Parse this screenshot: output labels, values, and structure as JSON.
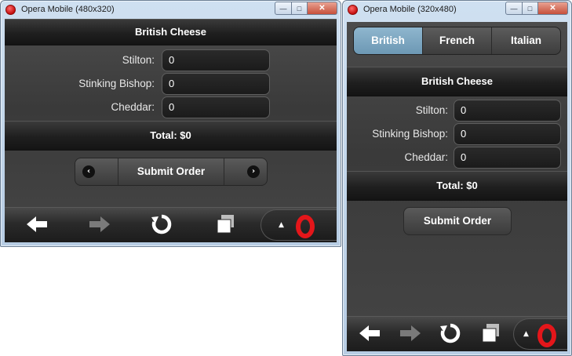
{
  "window_left": {
    "title": "Opera Mobile (480x320)",
    "header": "British Cheese",
    "fields": [
      {
        "label": "Stilton:",
        "value": "0"
      },
      {
        "label": "Stinking Bishop:",
        "value": "0"
      },
      {
        "label": "Cheddar:",
        "value": "0"
      }
    ],
    "total": "Total: $0",
    "submit_label": "Submit Order",
    "prev_icon": "chevron-left-icon",
    "next_icon": "chevron-right-icon"
  },
  "window_right": {
    "title": "Opera Mobile (320x480)",
    "tabs": [
      {
        "label": "British",
        "active": true
      },
      {
        "label": "French",
        "active": false
      },
      {
        "label": "Italian",
        "active": false
      }
    ],
    "header": "British Cheese",
    "fields": [
      {
        "label": "Stilton:",
        "value": "0"
      },
      {
        "label": "Stinking Bishop:",
        "value": "0"
      },
      {
        "label": "Cheddar:",
        "value": "0"
      }
    ],
    "total": "Total: $0",
    "submit_label": "Submit Order"
  },
  "window_controls": {
    "minimize": "—",
    "maximize": "□",
    "close": "✕"
  },
  "browser_bar": {
    "icons": [
      "back-arrow-icon",
      "forward-arrow-icon",
      "reload-icon",
      "tabs-icon",
      "opera-menu-icon"
    ],
    "menu_caret": "▲"
  },
  "colors": {
    "accent_tab": "#7fa9c3",
    "opera_red": "#e4161a",
    "panel_dark": "#3f3f3f"
  }
}
